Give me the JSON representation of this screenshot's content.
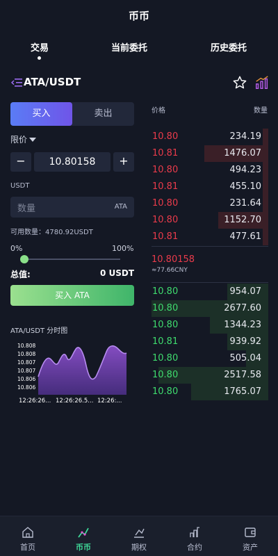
{
  "header": {
    "title": "币币"
  },
  "tabs": [
    {
      "label": "交易",
      "active": true
    },
    {
      "label": "当前委托",
      "active": false
    },
    {
      "label": "历史委托",
      "active": false
    }
  ],
  "pair": {
    "name": "ATA/USDT",
    "icons": [
      "menu-switch-icon",
      "star-icon",
      "chart-icon"
    ]
  },
  "trade_form": {
    "buy_label": "买入",
    "sell_label": "卖出",
    "order_type": "限价",
    "price_value": "10.80158",
    "minus_label": "−",
    "plus_label": "+",
    "currency_label": "USDT",
    "quantity_placeholder": "数量",
    "quantity_unit": "ATA",
    "available_text": "可用数量：4780.92USDT",
    "percent_min": "0%",
    "percent_max": "100%",
    "slider_value": 0,
    "total_label": "总值:",
    "total_value": "0 USDT",
    "submit_label": "买入 ATA"
  },
  "mini_chart": {
    "title": "ATA/USDT 分时图",
    "y_ticks": [
      "10.808",
      "10.808",
      "10.807",
      "10.807",
      "10.806",
      "10.806"
    ],
    "x_ticks": [
      "12:26:26...",
      "12:26:26.5...",
      "12:26:..."
    ],
    "fill_color": "#8a4fc9",
    "line_color": "#b78cf0"
  },
  "order_book": {
    "price_header": "价格",
    "qty_header": "数量",
    "asks": [
      {
        "price": "10.80",
        "qty": "234.19",
        "depth": 0.05
      },
      {
        "price": "10.81",
        "qty": "1476.07",
        "depth": 0.55
      },
      {
        "price": "10.80",
        "qty": "494.23",
        "depth": 0.05
      },
      {
        "price": "10.81",
        "qty": "455.10",
        "depth": 0.05
      },
      {
        "price": "10.80",
        "qty": "231.64",
        "depth": 0.05
      },
      {
        "price": "10.80",
        "qty": "1152.70",
        "depth": 0.43
      },
      {
        "price": "10.81",
        "qty": "477.61",
        "depth": 0.05
      }
    ],
    "last_price": "10.80158",
    "last_price_cny": "≈77.66CNY",
    "bids": [
      {
        "price": "10.80",
        "qty": "954.07",
        "depth": 0.35
      },
      {
        "price": "10.80",
        "qty": "2677.60",
        "depth": 1.0
      },
      {
        "price": "10.80",
        "qty": "1344.23",
        "depth": 0.5
      },
      {
        "price": "10.81",
        "qty": "939.92",
        "depth": 0.35
      },
      {
        "price": "10.80",
        "qty": "505.04",
        "depth": 0.19
      },
      {
        "price": "10.80",
        "qty": "2517.58",
        "depth": 0.94
      },
      {
        "price": "10.80",
        "qty": "1765.07",
        "depth": 0.66
      }
    ],
    "ask_color": "#ea3b4b",
    "bid_color": "#3fdb6e"
  },
  "bottom_nav": [
    {
      "label": "首页",
      "icon": "home-icon",
      "active": false
    },
    {
      "label": "币币",
      "icon": "coin-trade-icon",
      "active": true
    },
    {
      "label": "期权",
      "icon": "options-icon",
      "active": false
    },
    {
      "label": "合约",
      "icon": "contract-icon",
      "active": false
    },
    {
      "label": "资产",
      "icon": "wallet-icon",
      "active": false
    }
  ]
}
